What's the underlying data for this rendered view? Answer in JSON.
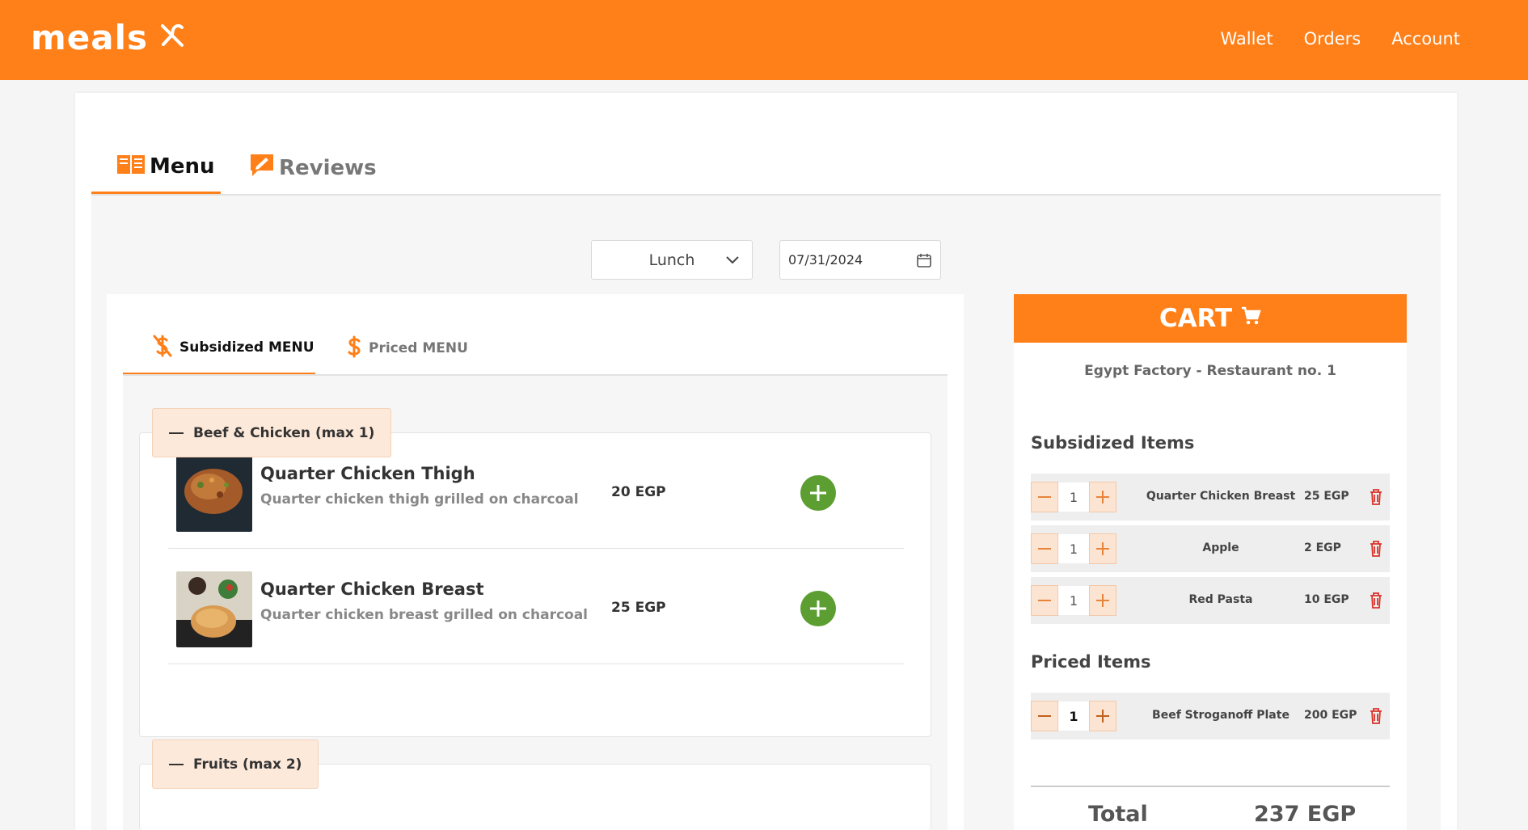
{
  "app": {
    "brand": "meals",
    "brand_color": "#ff7f18"
  },
  "nav": {
    "wallet": "Wallet",
    "orders": "Orders",
    "account": "Account"
  },
  "tabs": {
    "menu": "Menu",
    "reviews": "Reviews"
  },
  "filters": {
    "meal_type": "Lunch",
    "date": "07/31/2024"
  },
  "menu": {
    "subtabs": {
      "subsidized": "Subsidized MENU",
      "priced": "Priced MENU"
    },
    "categories": [
      {
        "title": "Beef & Chicken (max 1)",
        "items": [
          {
            "name": "Quarter Chicken Thigh",
            "description": "Quarter chicken thigh grilled on charcoal",
            "price": "20 EGP"
          },
          {
            "name": "Quarter Chicken Breast",
            "description": "Quarter chicken breast grilled on charcoal",
            "price": "25 EGP"
          }
        ]
      },
      {
        "title": "Fruits (max 2)",
        "items": []
      }
    ]
  },
  "cart": {
    "title": "CART",
    "restaurant": "Egypt Factory - Restaurant no. 1",
    "subsidized_title": "Subsidized Items",
    "subsidized": [
      {
        "qty": "1",
        "name": "Quarter Chicken Breast",
        "price": "25 EGP"
      },
      {
        "qty": "1",
        "name": "Apple",
        "price": "2 EGP"
      },
      {
        "qty": "1",
        "name": "Red Pasta",
        "price": "10 EGP"
      }
    ],
    "priced_title": "Priced Items",
    "priced": [
      {
        "qty": "1",
        "name": "Beef Stroganoff Plate",
        "price": "200 EGP"
      }
    ],
    "total_label": "Total",
    "total_value": "237 EGP"
  }
}
